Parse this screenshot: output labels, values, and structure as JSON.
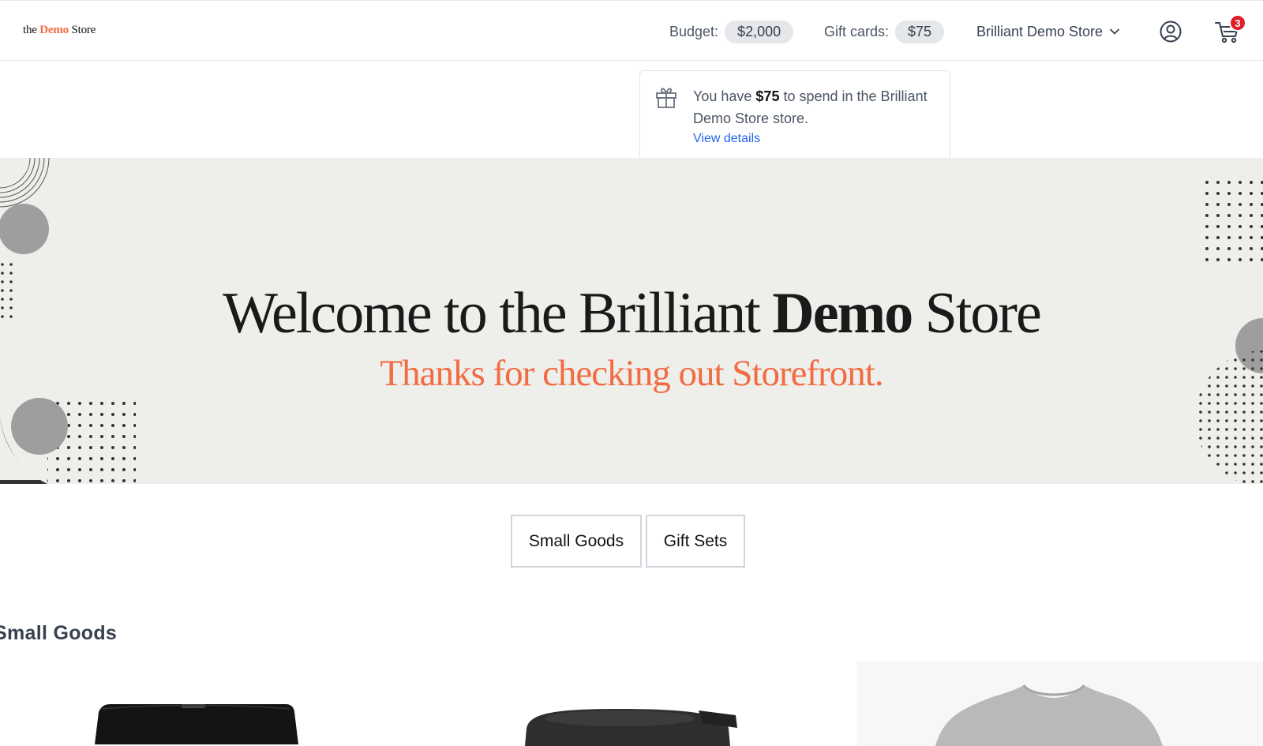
{
  "header": {
    "logo": {
      "pre": "the ",
      "accent": "Demo",
      "post": " Store"
    },
    "budget": {
      "label": "Budget:",
      "value": "$2,000"
    },
    "gift_cards": {
      "label": "Gift cards:",
      "value": "$75"
    },
    "store_selector": {
      "label": "Brilliant Demo Store"
    },
    "cart_count": "3"
  },
  "popover": {
    "pre": "You have ",
    "amount": "$75",
    "post": " to spend in the Brilliant Demo Store store.",
    "link": "View details"
  },
  "hero": {
    "title_pre": "Welcome to the Brilliant ",
    "title_bold": "Demo",
    "title_post": " Store",
    "subtitle": "Thanks for checking out Storefront."
  },
  "categories": [
    "Small Goods",
    "Gift Sets"
  ],
  "section": {
    "title": "Small Goods"
  },
  "colors": {
    "accent": "#f26b43",
    "link": "#2563eb",
    "badge": "#e11d2a",
    "hero_bg": "#eeeeea"
  }
}
